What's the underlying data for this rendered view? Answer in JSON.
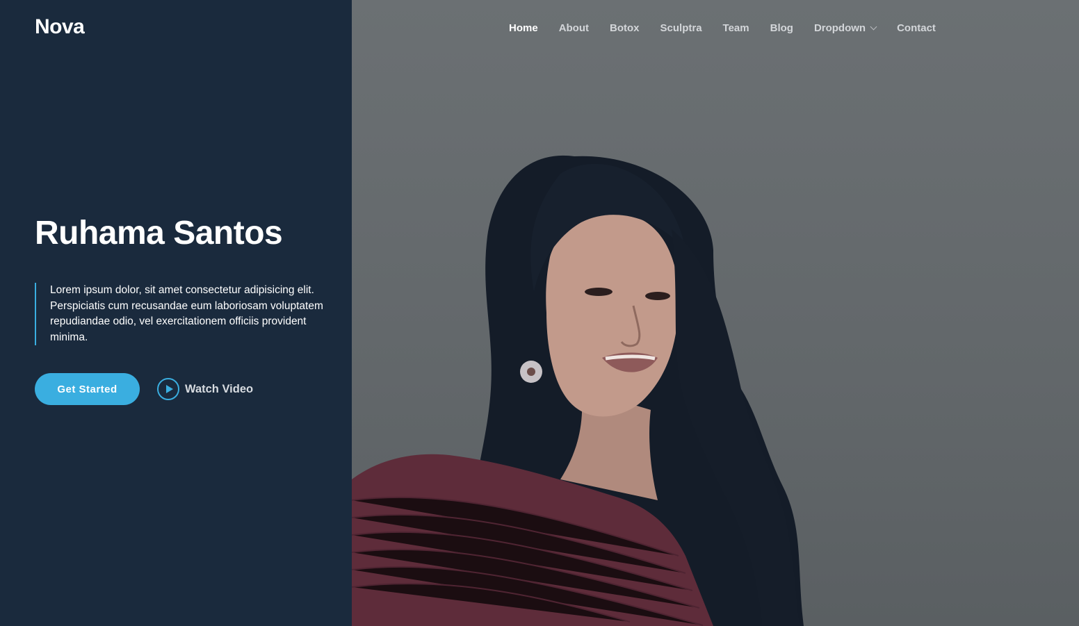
{
  "brand": {
    "logo": "Nova"
  },
  "nav": {
    "items": [
      {
        "label": "Home",
        "active": true
      },
      {
        "label": "About"
      },
      {
        "label": "Botox"
      },
      {
        "label": "Sculptra"
      },
      {
        "label": "Team"
      },
      {
        "label": "Blog"
      },
      {
        "label": "Dropdown",
        "icon": "chevron-down-icon"
      },
      {
        "label": "Contact"
      }
    ]
  },
  "hero": {
    "title": "Ruhama Santos",
    "description": "Lorem ipsum dolor, sit amet consectetur adipisicing elit. Perspiciatis cum recusandae eum laboriosam voluptatem repudiandae odio, vel exercitationem officiis provident minima.",
    "primary_button": "Get Started",
    "video_button": "Watch Video",
    "video_icon": "play-circle-icon"
  },
  "colors": {
    "panel": "#1a2a3d",
    "accent": "#3aaee0",
    "image_overlay": "#62676a"
  }
}
